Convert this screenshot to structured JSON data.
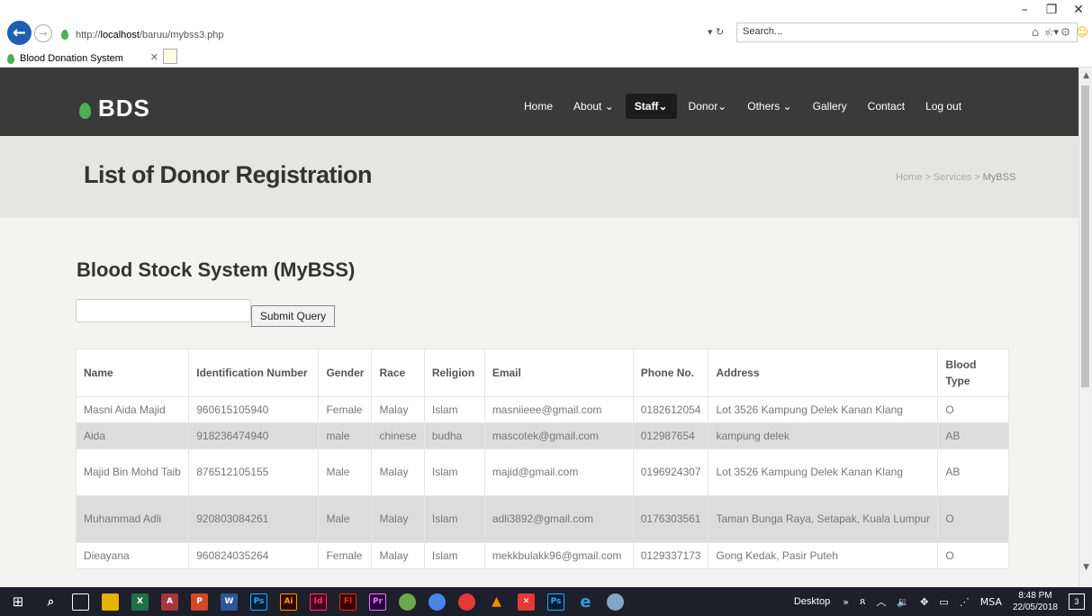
{
  "window": {
    "minimize_icon": "minimize-icon",
    "restore_icon": "restore-icon",
    "close_icon": "close-icon"
  },
  "browser": {
    "url_prefix": "http://",
    "url_host": "localhost",
    "url_path": "/baruu/mybss3.php",
    "search_placeholder": "Search...",
    "tab_title": "Blood Donation System"
  },
  "site": {
    "logo_text": "BDS",
    "brand_color": "#4caf50",
    "nav": [
      {
        "label": "Home",
        "active": false
      },
      {
        "label": "About ⌄",
        "active": false
      },
      {
        "label": "Staff⌄",
        "active": true
      },
      {
        "label": "Donor⌄",
        "active": false
      },
      {
        "label": "Others ⌄",
        "active": false
      },
      {
        "label": "Gallery",
        "active": false
      },
      {
        "label": "Contact",
        "active": false
      },
      {
        "label": "Log out",
        "active": false
      }
    ],
    "banner_title": "List of Donor Registration",
    "breadcrumb": {
      "home": "Home",
      "sep1": " > ",
      "services": "Services",
      "sep2": " > ",
      "current": "MyBSS"
    }
  },
  "main": {
    "section_title": "Blood Stock System (MyBSS)",
    "search_value": "",
    "submit_label": "Submit Query"
  },
  "table": {
    "headers": [
      "Name",
      "Identification Number",
      "Gender",
      "Race",
      "Religion",
      "Email",
      "Phone No.",
      "Address",
      "Blood Type"
    ],
    "rows": [
      [
        "Masni Aida Majid",
        "960615105940",
        "Female",
        "Malay",
        "Islam",
        "masniieee@gmail.com",
        "0182612054",
        "Lot 3526 Kampung Delek Kanan Klang",
        "O"
      ],
      [
        "Aida",
        "918236474940",
        "male",
        "chinese",
        "budha",
        "mascotek@gmail.com",
        "012987654",
        "kampung delek",
        "AB"
      ],
      [
        "Majid Bin Mohd Taib",
        "876512105155",
        "Male",
        "Malay",
        "Islam",
        "majid@gmail.com",
        "0196924307",
        "Lot 3526 Kampung Delek Kanan Klang",
        "AB"
      ],
      [
        "Muhammad Adli",
        "920803084261",
        "Male",
        "Malay",
        "Islam",
        "adli3892@gmail.com",
        "0176303561",
        "Taman Bunga Raya, Setapak, Kuala Lumpur",
        "O"
      ],
      [
        "Dieayana",
        "960824035264",
        "Female",
        "Malay",
        "Islam",
        "mekkbulakk96@gmail.com",
        "0129337173",
        "Gong Kedak, Pasir Puteh",
        "O"
      ]
    ]
  },
  "taskbar": {
    "desktop_label": "Desktop",
    "language": "MSA",
    "time": "8:48 PM",
    "date": "22/05/2018",
    "notification_count": "3"
  }
}
